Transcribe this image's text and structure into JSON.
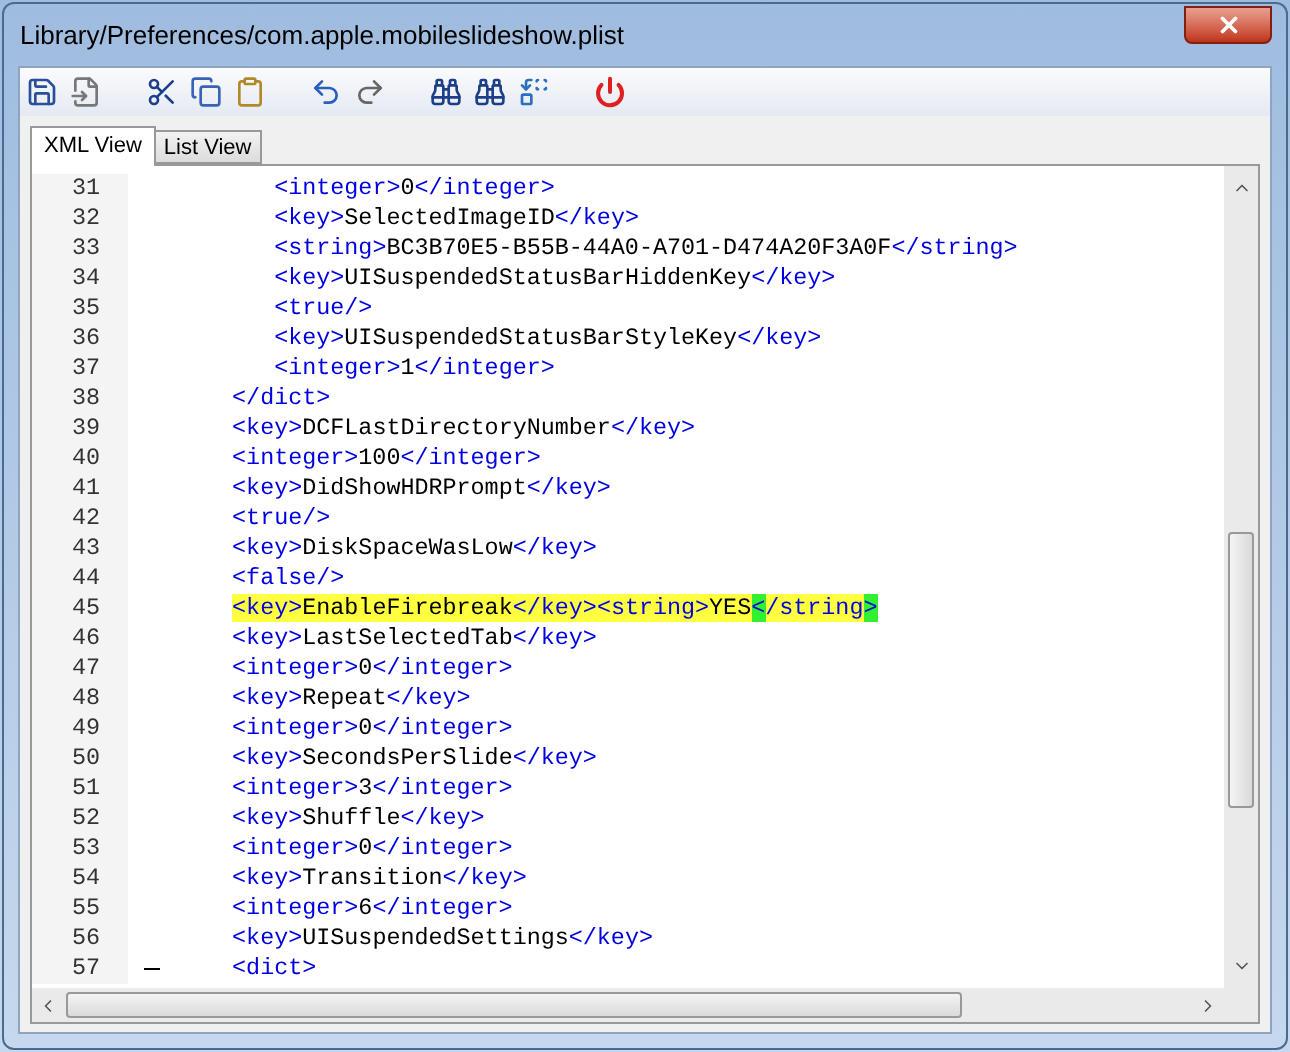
{
  "window": {
    "title": "Library/Preferences/com.apple.mobileslideshow.plist"
  },
  "tabs": [
    {
      "label": "XML View",
      "selected": true
    },
    {
      "label": "List View",
      "selected": false
    }
  ],
  "editor": {
    "lines": [
      {
        "number": "31",
        "text": "      <integer>0</integer>",
        "highlighted": false,
        "fold": false
      },
      {
        "number": "32",
        "text": "      <key>SelectedImageID</key>",
        "highlighted": false,
        "fold": false
      },
      {
        "number": "33",
        "text": "      <string>BC3B70E5-B55B-44A0-A701-D474A20F3A0F</string>",
        "highlighted": false,
        "fold": false
      },
      {
        "number": "34",
        "text": "      <key>UISuspendedStatusBarHiddenKey</key>",
        "highlighted": false,
        "fold": false
      },
      {
        "number": "35",
        "text": "      <true/>",
        "highlighted": false,
        "fold": false
      },
      {
        "number": "36",
        "text": "      <key>UISuspendedStatusBarStyleKey</key>",
        "highlighted": false,
        "fold": false
      },
      {
        "number": "37",
        "text": "      <integer>1</integer>",
        "highlighted": false,
        "fold": false
      },
      {
        "number": "38",
        "text": "   </dict>",
        "highlighted": false,
        "fold": false
      },
      {
        "number": "39",
        "text": "   <key>DCFLastDirectoryNumber</key>",
        "highlighted": false,
        "fold": false
      },
      {
        "number": "40",
        "text": "   <integer>100</integer>",
        "highlighted": false,
        "fold": false
      },
      {
        "number": "41",
        "text": "   <key>DidShowHDRPrompt</key>",
        "highlighted": false,
        "fold": false
      },
      {
        "number": "42",
        "text": "   <true/>",
        "highlighted": false,
        "fold": false
      },
      {
        "number": "43",
        "text": "   <key>DiskSpaceWasLow</key>",
        "highlighted": false,
        "fold": false
      },
      {
        "number": "44",
        "text": "   <false/>",
        "highlighted": false,
        "fold": false
      },
      {
        "number": "45",
        "text": "   <key>EnableFirebreak</key><string>YES</string>",
        "highlighted": true,
        "fold": false
      },
      {
        "number": "46",
        "text": "   <key>LastSelectedTab</key>",
        "highlighted": false,
        "fold": false
      },
      {
        "number": "47",
        "text": "   <integer>0</integer>",
        "highlighted": false,
        "fold": false
      },
      {
        "number": "48",
        "text": "   <key>Repeat</key>",
        "highlighted": false,
        "fold": false
      },
      {
        "number": "49",
        "text": "   <integer>0</integer>",
        "highlighted": false,
        "fold": false
      },
      {
        "number": "50",
        "text": "   <key>SecondsPerSlide</key>",
        "highlighted": false,
        "fold": false
      },
      {
        "number": "51",
        "text": "   <integer>3</integer>",
        "highlighted": false,
        "fold": false
      },
      {
        "number": "52",
        "text": "   <key>Shuffle</key>",
        "highlighted": false,
        "fold": false
      },
      {
        "number": "53",
        "text": "   <integer>0</integer>",
        "highlighted": false,
        "fold": false
      },
      {
        "number": "54",
        "text": "   <key>Transition</key>",
        "highlighted": false,
        "fold": false
      },
      {
        "number": "55",
        "text": "   <integer>6</integer>",
        "highlighted": false,
        "fold": false
      },
      {
        "number": "56",
        "text": "   <key>UISuspendedSettings</key>",
        "highlighted": false,
        "fold": false
      },
      {
        "number": "57",
        "text": "   <dict>",
        "highlighted": false,
        "fold": true
      }
    ]
  }
}
